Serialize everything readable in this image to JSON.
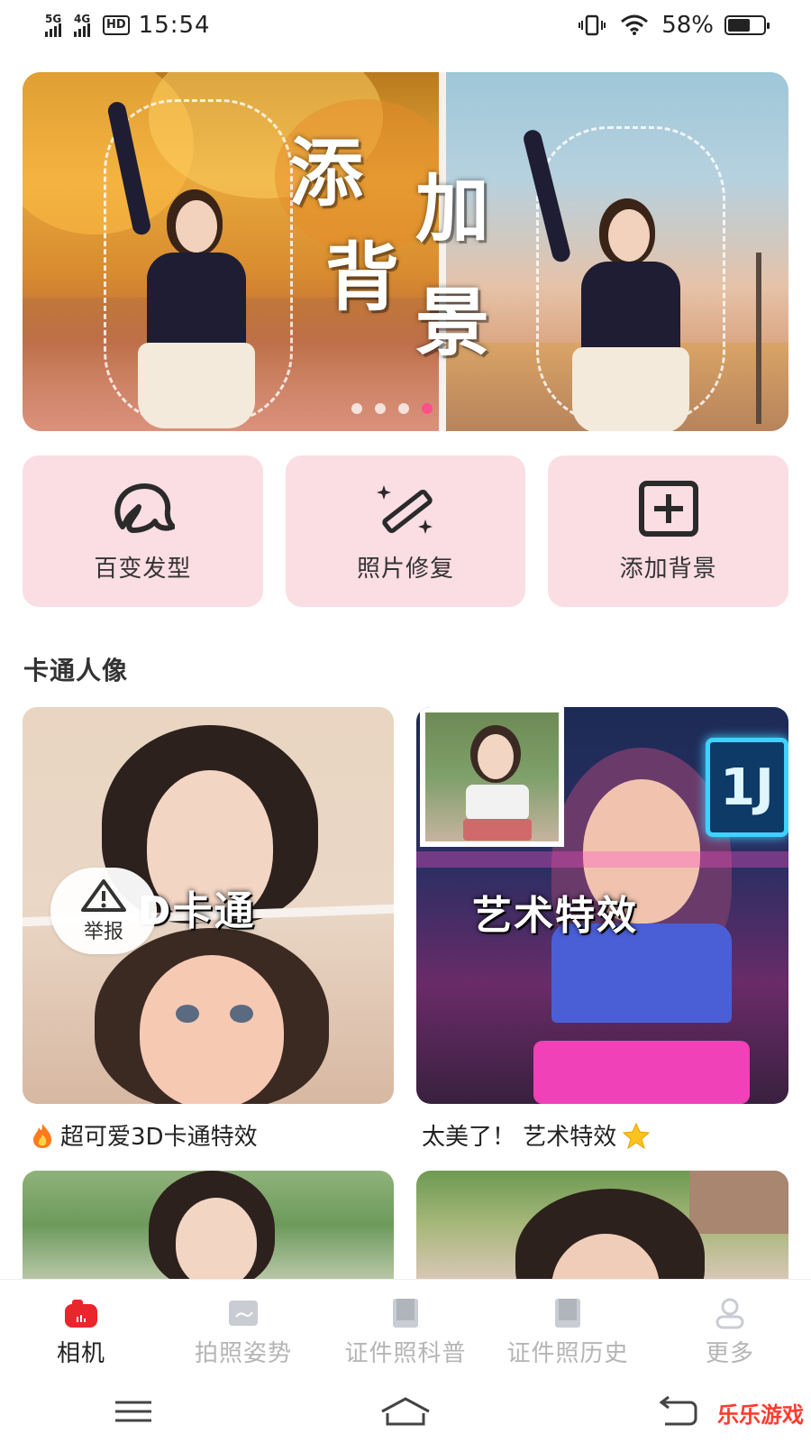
{
  "status_bar": {
    "net1": "5G",
    "net2": "4G",
    "hd": "HD",
    "time": "15:54",
    "battery": "58%"
  },
  "banner": {
    "title_chars": [
      "添",
      "加",
      "背",
      "景"
    ],
    "page_count": 4,
    "active_page": 4
  },
  "quick_actions": [
    {
      "label": "百变发型",
      "icon": "hair-icon"
    },
    {
      "label": "照片修复",
      "icon": "magic-wand-icon"
    },
    {
      "label": "添加背景",
      "icon": "add-box-icon"
    }
  ],
  "section": {
    "title": "卡通人像"
  },
  "cards": [
    {
      "overlay": "D卡通",
      "caption": "超可爱3D卡通特效",
      "caption_prefix_icon": "fire-icon"
    },
    {
      "overlay": "艺术特效",
      "caption": "太美了！ 艺术特效",
      "caption_suffix_icon": "star-icon",
      "sign": "1J"
    }
  ],
  "report": {
    "label": "举报",
    "icon": "warning-icon"
  },
  "bottom_nav": [
    {
      "label": "相机",
      "icon": "camera-icon",
      "active": true
    },
    {
      "label": "拍照姿势",
      "icon": "image-icon",
      "active": false
    },
    {
      "label": "证件照科普",
      "icon": "book-icon",
      "active": false
    },
    {
      "label": "证件照历史",
      "icon": "book-icon",
      "active": false
    },
    {
      "label": "更多",
      "icon": "user-icon",
      "active": false
    }
  ],
  "watermark": "乐乐游戏",
  "colors": {
    "accent": "#ff4f8b",
    "action_bg": "#fbdde4",
    "nav_active": "#e8262b",
    "nav_inactive": "#b5b5b5"
  }
}
